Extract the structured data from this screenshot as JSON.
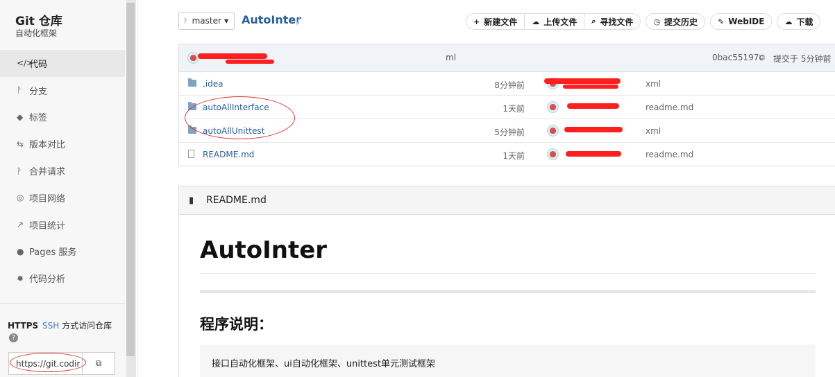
{
  "sidebar": {
    "title": "Git 仓库",
    "subtitle": "自动化框架",
    "items": [
      {
        "icon": "code-icon",
        "glyph": "</>",
        "label": "代码"
      },
      {
        "icon": "branch-icon",
        "glyph": "ᚹ",
        "label": "分支"
      },
      {
        "icon": "tag-icon",
        "glyph": "◆",
        "label": "标签"
      },
      {
        "icon": "compare-icon",
        "glyph": "⇆",
        "label": "版本对比"
      },
      {
        "icon": "merge-icon",
        "glyph": "ᚹ",
        "label": "合并请求"
      },
      {
        "icon": "network-icon",
        "glyph": "◎",
        "label": "项目网络"
      },
      {
        "icon": "stats-icon",
        "glyph": "↗",
        "label": "项目统计"
      },
      {
        "icon": "globe-icon",
        "glyph": "●",
        "label": "Pages 服务"
      },
      {
        "icon": "analysis-icon",
        "glyph": "✹",
        "label": "代码分析"
      }
    ],
    "proto_https": "HTTPS",
    "proto_ssh": "SSH",
    "proto_suffix": "方式访问仓库",
    "help_glyph": "?",
    "clone_url": "https://git.codir",
    "copy_glyph": "⧉"
  },
  "topbar": {
    "branch": "master",
    "repo_name": "AutoInter",
    "slash": "/",
    "actions": [
      {
        "icon": "plus-icon",
        "glyph": "+",
        "label": "新建文件"
      },
      {
        "icon": "upload-icon",
        "glyph": "☁",
        "label": "上传文件"
      },
      {
        "icon": "search-icon",
        "glyph": "⌕",
        "label": "寻找文件"
      },
      {
        "icon": "history-icon",
        "glyph": "◷",
        "label": "提交历史"
      },
      {
        "icon": "edit-icon",
        "glyph": "✎",
        "label": "WebIDE"
      },
      {
        "icon": "download-icon",
        "glyph": "☁",
        "label": "下载"
      }
    ]
  },
  "commit": {
    "message_tail": "ml",
    "hash": "0bac55197c",
    "time": "提交于 5分钟前"
  },
  "files": [
    {
      "type": "folder",
      "name": ".idea",
      "time": "8分钟前",
      "message": "xml"
    },
    {
      "type": "folder",
      "name": "autoAllInterface",
      "time": "1天前",
      "message": "readme.md"
    },
    {
      "type": "folder",
      "name": "autoAllUnittest",
      "time": "5分钟前",
      "message": "xml"
    },
    {
      "type": "file",
      "name": "README.md",
      "time": "1天前",
      "message": "readme.md"
    }
  ],
  "readme": {
    "header": "README.md",
    "h1": "AutoInter",
    "h2": "程序说明：",
    "code_text": "接口自动化框架、ui自动化框架、unittest单元测试框架"
  },
  "colors": {
    "link": "#2a5f9e",
    "annotation_red": "#e23030",
    "sidebar_bg": "#f7f7f7"
  }
}
